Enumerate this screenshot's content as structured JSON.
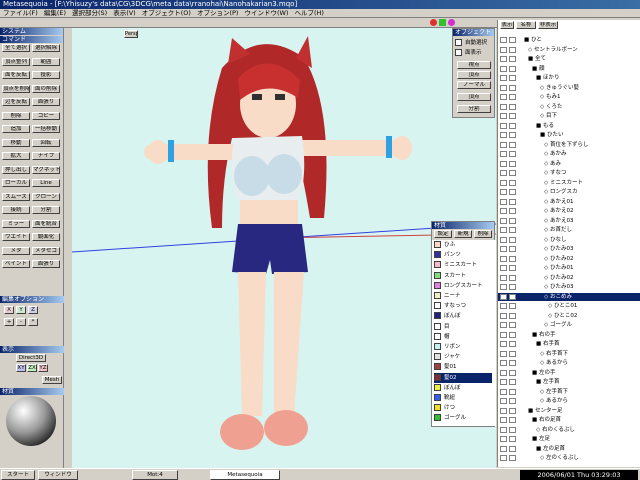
{
  "window": {
    "title": "Metasequoia - [F:\\Yhisuzy's data\\CG\\3DCG\\meta data\\rranohai\\Nanohakarian3.mqo]"
  },
  "menu": [
    "ファイル(F)",
    "編集(E)",
    "選択部分(S)",
    "表示(V)",
    "オブジェクト(O)",
    "オプション(P)",
    "ウインドウ(W)",
    "ヘルプ(H)"
  ],
  "left": {
    "system": "システム",
    "command": "コマンド",
    "edit": "編集",
    "buttons": [
      "全て選択",
      "選択解除",
      "頂点整列",
      "範囲",
      "面を反転",
      "投影",
      "頂点を削除",
      "面の削除",
      "辺を反転",
      "面張り",
      "削除",
      "コピー",
      "追加",
      "一括移動",
      "移動",
      "回転",
      "拡大",
      "ナイフ",
      "押し出し",
      "マグネット",
      "ローカル",
      "Line",
      "スムーズ",
      "クローン",
      "接続",
      "分割",
      "ミラー",
      "面を統合",
      "ウエイト",
      "鏡面化",
      "メタ",
      "メタセコ",
      "ペイント",
      "面張り"
    ],
    "viewpoint": "視点",
    "edit_option": "編集オプション",
    "display": "表示",
    "display_values": [
      "Direct3D",
      "XY",
      "ZX",
      "YZ",
      "Mesh"
    ],
    "material_label": "材質"
  },
  "viewport": {
    "label": "Persp"
  },
  "right_buttons": {
    "header": "オブジェクト",
    "items": [
      "表示"
    ],
    "toggles": [
      "自動選択",
      "面表示"
    ],
    "actions": [
      "視点",
      "頂点",
      "ノーマル",
      "頂点",
      "分割"
    ]
  },
  "material_panel": {
    "title": "材質",
    "tabs": [
      "設定",
      "新規",
      "削除"
    ],
    "colors": [
      {
        "name": "ひふ",
        "color": "#f8d8c0"
      },
      {
        "name": "パンツ",
        "color": "#3030a0"
      },
      {
        "name": "ミニスカート",
        "color": "#f8b8c8"
      },
      {
        "name": "スカート",
        "color": "#80e080"
      },
      {
        "name": "ロングスカート",
        "color": "#e080e0"
      },
      {
        "name": "ニーナ",
        "color": "#f0f0c0"
      },
      {
        "name": "すなっつ",
        "color": "#ffffff"
      },
      {
        "name": "ぼんぼ",
        "color": "#202080"
      },
      {
        "name": "目",
        "color": "#ffffff"
      },
      {
        "name": "帽",
        "color": "#ffffff"
      },
      {
        "name": "リボン",
        "color": "#c0f0f0"
      },
      {
        "name": "ジャケ",
        "color": "#e0e0e0"
      },
      {
        "name": "髪01",
        "color": "#a04040"
      },
      {
        "name": "髪02",
        "color": "#803030"
      },
      {
        "name": "ぼんぼ",
        "color": "#f0f040"
      },
      {
        "name": "靴紐",
        "color": "#3060f0"
      },
      {
        "name": "けつ",
        "color": "#f0e020"
      },
      {
        "name": "ゴーグル",
        "color": "#30c030"
      }
    ]
  },
  "tree": {
    "tabs": [
      "表示",
      "名称",
      "非表示"
    ],
    "rows": [
      {
        "label": "■ ひと",
        "indent": 4
      },
      {
        "label": "◇ セントラルボーン",
        "indent": 8
      },
      {
        "label": "■ 全て",
        "indent": 8
      },
      {
        "label": "■ 顔",
        "indent": 12
      },
      {
        "label": "■ ほかり",
        "indent": 16
      },
      {
        "label": "◇ きゅうぐい髪",
        "indent": 20
      },
      {
        "label": "◇ もみ1",
        "indent": 20
      },
      {
        "label": "◇ くろた",
        "indent": 20
      },
      {
        "label": "◇ 目下",
        "indent": 20
      },
      {
        "label": "■ もる",
        "indent": 16
      },
      {
        "label": "■ ひたい",
        "indent": 20
      },
      {
        "label": "◇ 首位を下ずらし",
        "indent": 24
      },
      {
        "label": "◇ あかみ",
        "indent": 24
      },
      {
        "label": "◇ あみ",
        "indent": 24
      },
      {
        "label": "◇ すなつ",
        "indent": 24
      },
      {
        "label": "◇ ミニスカート",
        "indent": 24
      },
      {
        "label": "◇ ロングスカ",
        "indent": 24
      },
      {
        "label": "◇ あかえ01",
        "indent": 24
      },
      {
        "label": "◇ あかえ02",
        "indent": 24
      },
      {
        "label": "◇ あかえ03",
        "indent": 24
      },
      {
        "label": "◇ お首だし",
        "indent": 24
      },
      {
        "label": "◇ ひなし",
        "indent": 24
      },
      {
        "label": "◇ ひたみ03",
        "indent": 24
      },
      {
        "label": "◇ ひたみ02",
        "indent": 24
      },
      {
        "label": "◇ ひたみ01",
        "indent": 24
      },
      {
        "label": "◇ ひたみ02",
        "indent": 24
      },
      {
        "label": "◇ ひたみ03",
        "indent": 24
      },
      {
        "label": "◇ おこめみ",
        "indent": 24,
        "selected": true
      },
      {
        "label": "◇ ひとこ01",
        "indent": 28
      },
      {
        "label": "◇ ひとこ02",
        "indent": 28
      },
      {
        "label": "◇ ゴーグル",
        "indent": 24
      },
      {
        "label": "■ 右の手",
        "indent": 12
      },
      {
        "label": "■ 右手首",
        "indent": 16
      },
      {
        "label": "◇ 右手首下",
        "indent": 20
      },
      {
        "label": "◇ あるから",
        "indent": 20
      },
      {
        "label": "■ 左の手",
        "indent": 12
      },
      {
        "label": "■ 左手首",
        "indent": 16
      },
      {
        "label": "◇ 左手首下",
        "indent": 20
      },
      {
        "label": "◇ あるから",
        "indent": 20
      },
      {
        "label": "■ センター足",
        "indent": 8
      },
      {
        "label": "■ 右の足首",
        "indent": 12
      },
      {
        "label": "◇ 右のくるぶし",
        "indent": 16
      },
      {
        "label": "■ 左足",
        "indent": 12
      },
      {
        "label": "■ 左の足首",
        "indent": 16
      },
      {
        "label": "◇ 左のくるぶし",
        "indent": 20
      }
    ]
  },
  "taskbar": {
    "start": "スタート",
    "items": [
      "ウィンドウ",
      "Mot:4",
      "Metasequoia"
    ],
    "clock": "2006/06/01 Thu 03:29:03"
  }
}
